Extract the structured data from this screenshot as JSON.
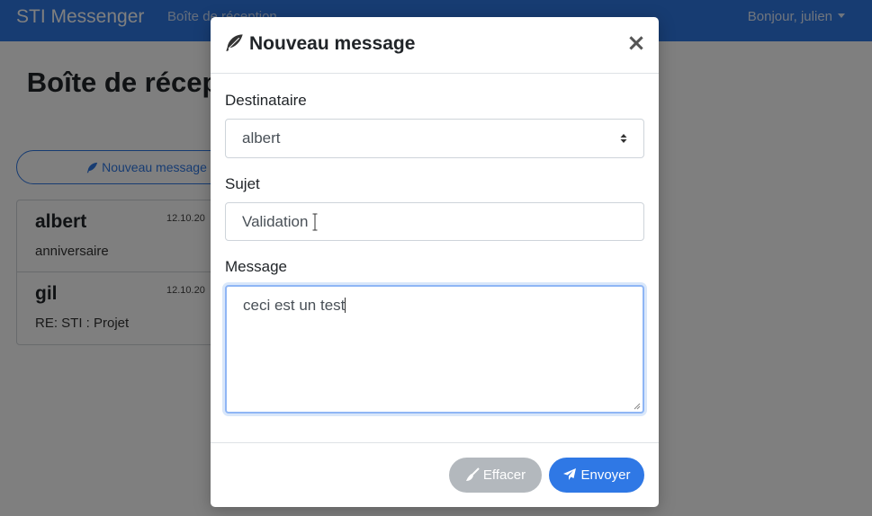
{
  "navbar": {
    "brand": "STI Messenger",
    "inbox_link": "Boîte de réception",
    "greeting": "Bonjour, julien"
  },
  "page": {
    "title": "Boîte de réception",
    "new_message_button": "Nouveau message"
  },
  "messages": [
    {
      "sender": "albert",
      "date": "12.10.20",
      "subject": "anniversaire"
    },
    {
      "sender": "gil",
      "date": "12.10.20",
      "subject": "RE: STI : Projet"
    }
  ],
  "modal": {
    "title": "Nouveau message",
    "close_symbol": "×",
    "recipient_label": "Destinataire",
    "recipient_value": "albert",
    "subject_label": "Sujet",
    "subject_value": "Validation",
    "message_label": "Message",
    "message_value": "ceci est un test",
    "clear_button": "Effacer",
    "send_button": "Envoyer"
  },
  "colors": {
    "primary": "#2f78e5",
    "secondary": "#b3b8bd",
    "focus_border": "#8fb6f5"
  },
  "icons": {
    "title": "feather-icon",
    "clear": "broom-icon",
    "send": "paper-plane-icon",
    "new_message": "feather-icon"
  }
}
